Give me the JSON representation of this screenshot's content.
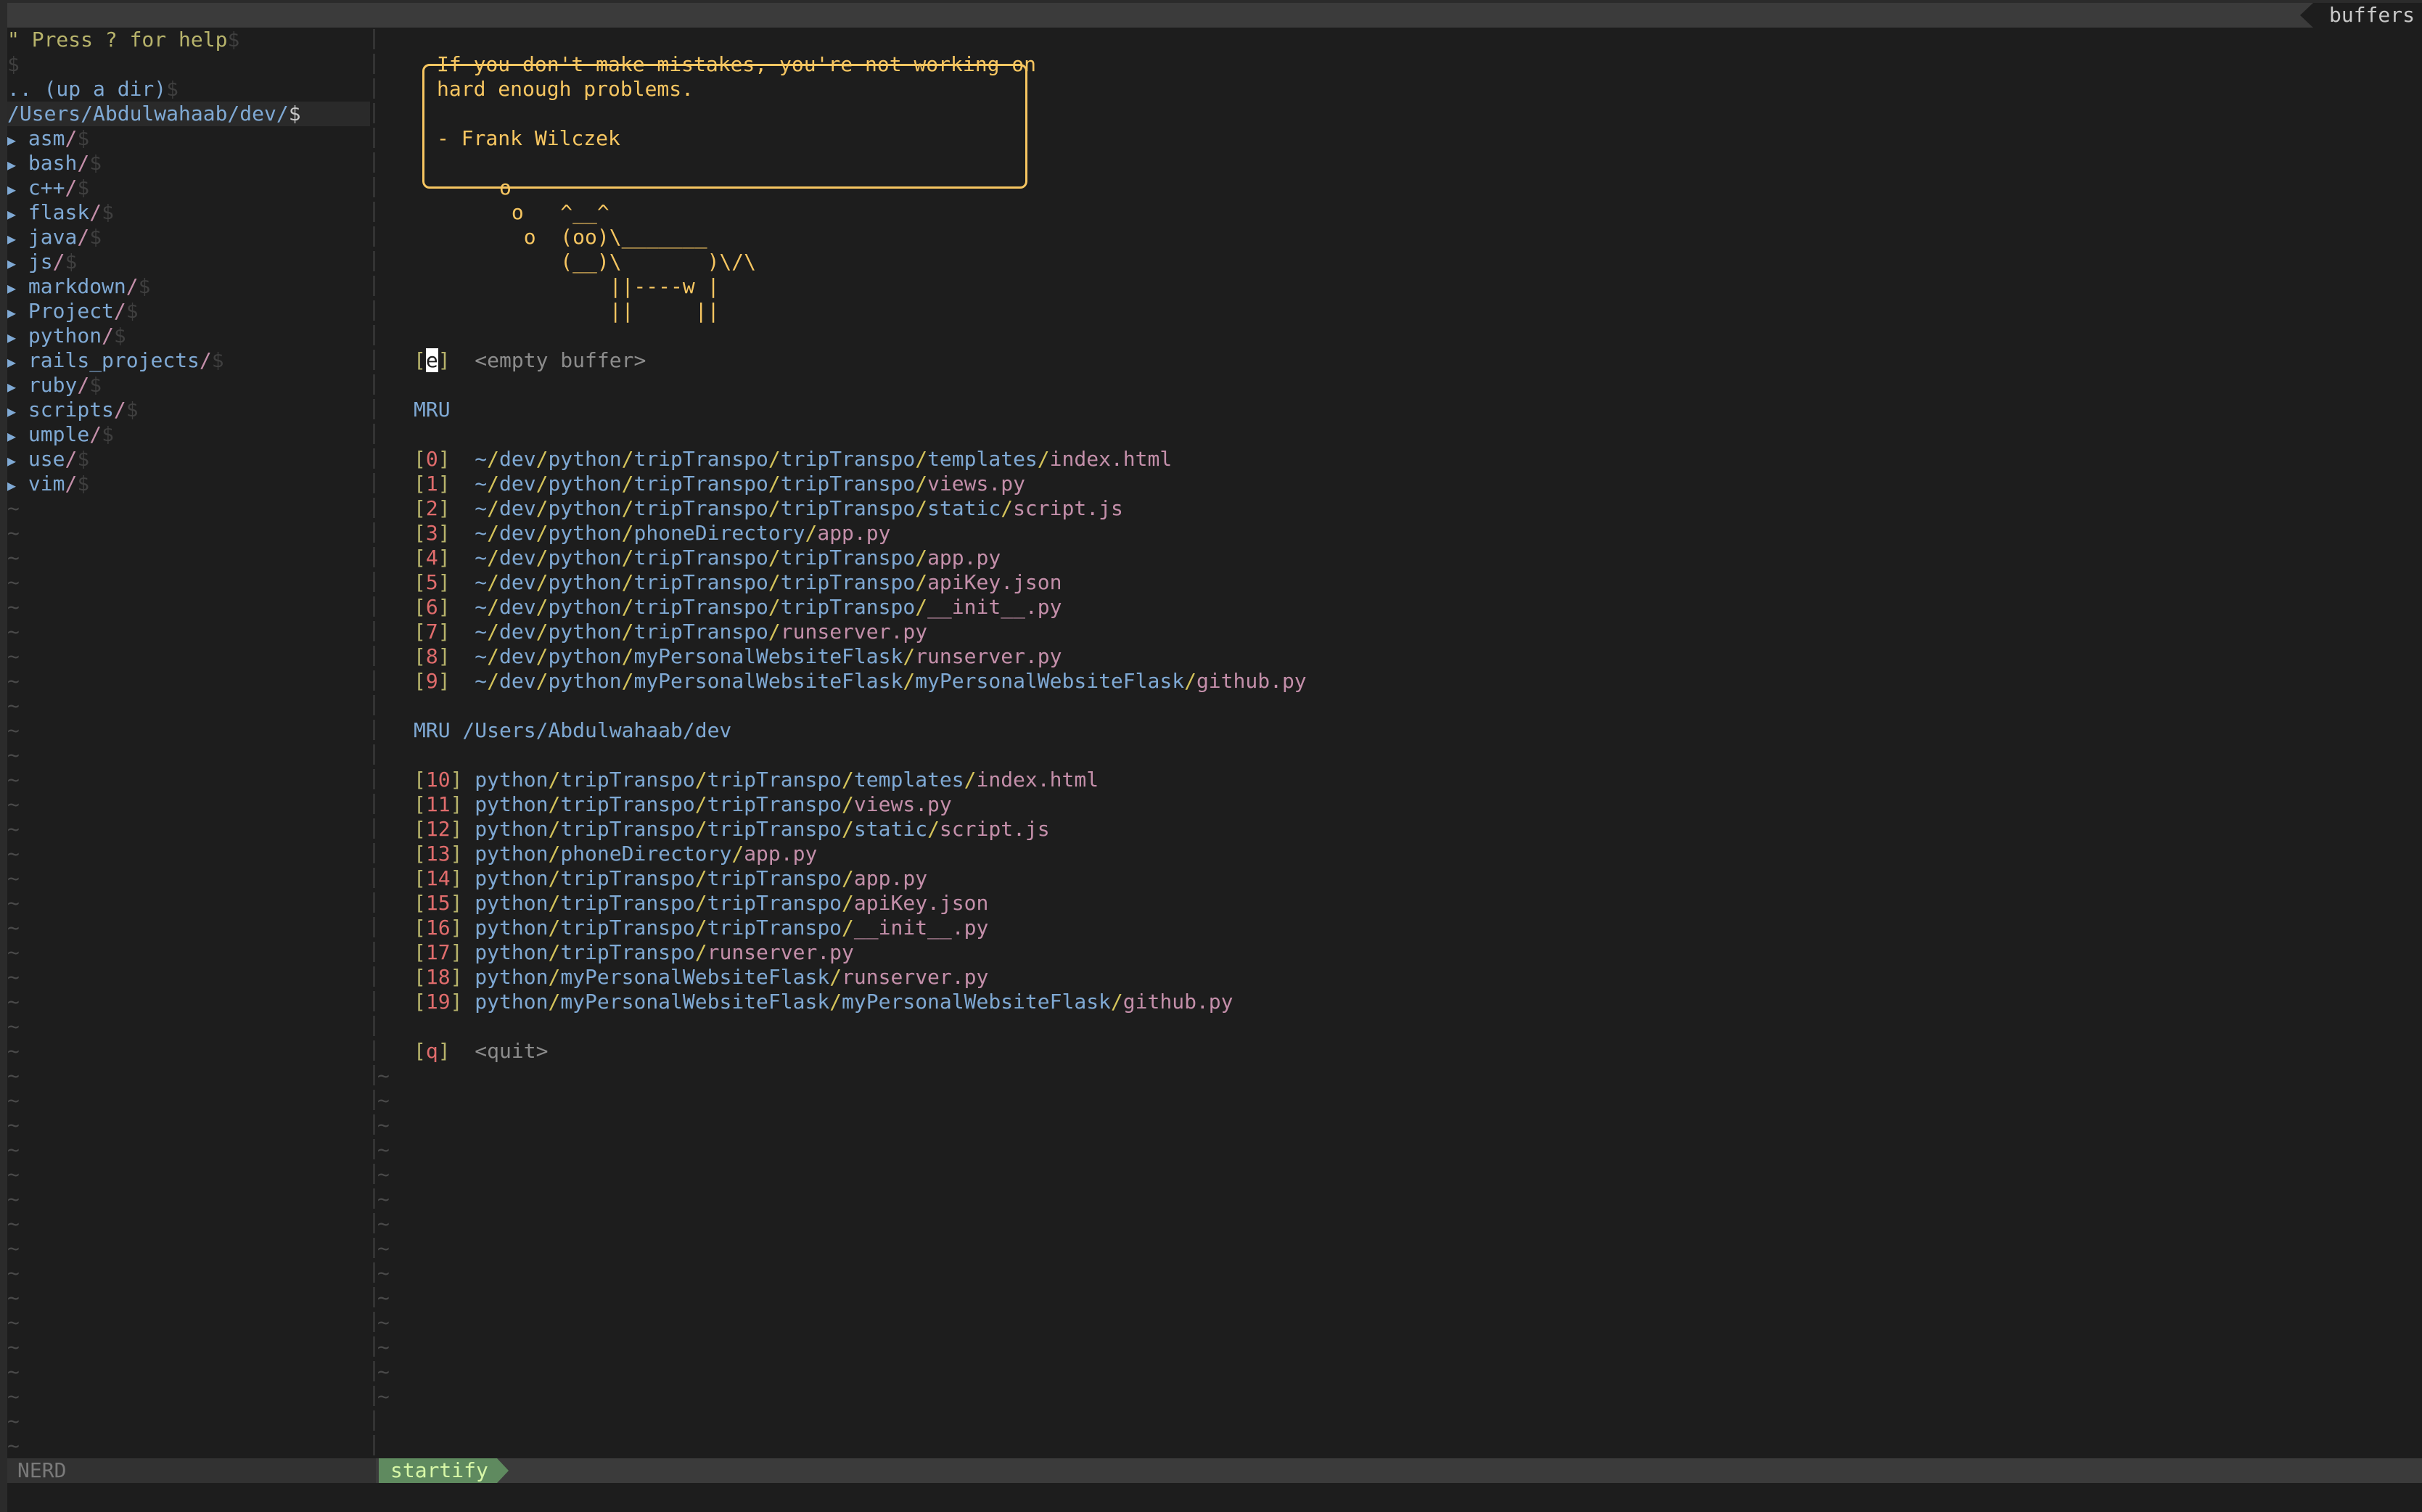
{
  "tabline": {
    "right_label": "buffers"
  },
  "sidebar": {
    "help_text": "\" Press ? for help",
    "eol_marker": "$",
    "up_dir": ".. (up a dir)",
    "root_path": "/Users/Abdulwahaab/dev/",
    "items": [
      {
        "name": "asm"
      },
      {
        "name": "bash"
      },
      {
        "name": "c++"
      },
      {
        "name": "flask"
      },
      {
        "name": "java"
      },
      {
        "name": "js"
      },
      {
        "name": "markdown"
      },
      {
        "name": "Project"
      },
      {
        "name": "python"
      },
      {
        "name": "rails_projects"
      },
      {
        "name": "ruby"
      },
      {
        "name": "scripts"
      },
      {
        "name": "umple"
      },
      {
        "name": "use"
      },
      {
        "name": "vim"
      }
    ],
    "tilde": "~"
  },
  "startify": {
    "quote_lines": [
      "If you don't make mistakes, you're not working on",
      "hard enough problems.",
      "",
      "- Frank Wilczek"
    ],
    "cow_lines": [
      "       o",
      "        o   ^__^",
      "         o  (oo)\\_______",
      "            (__)\\       )\\/\\",
      "                ||----w |",
      "                ||     ||"
    ],
    "empty_buffer": {
      "key": "e",
      "label": "<empty buffer>"
    },
    "mru_header": "MRU",
    "mru": [
      {
        "key": "0",
        "prefix": "~/",
        "dirs": [
          "dev",
          "python",
          "tripTranspo",
          "tripTranspo",
          "templates"
        ],
        "file": "index.html"
      },
      {
        "key": "1",
        "prefix": "~/",
        "dirs": [
          "dev",
          "python",
          "tripTranspo",
          "tripTranspo"
        ],
        "file": "views.py"
      },
      {
        "key": "2",
        "prefix": "~/",
        "dirs": [
          "dev",
          "python",
          "tripTranspo",
          "tripTranspo",
          "static"
        ],
        "file": "script.js"
      },
      {
        "key": "3",
        "prefix": "~/",
        "dirs": [
          "dev",
          "python",
          "phoneDirectory"
        ],
        "file": "app.py"
      },
      {
        "key": "4",
        "prefix": "~/",
        "dirs": [
          "dev",
          "python",
          "tripTranspo",
          "tripTranspo"
        ],
        "file": "app.py"
      },
      {
        "key": "5",
        "prefix": "~/",
        "dirs": [
          "dev",
          "python",
          "tripTranspo",
          "tripTranspo"
        ],
        "file": "apiKey.json"
      },
      {
        "key": "6",
        "prefix": "~/",
        "dirs": [
          "dev",
          "python",
          "tripTranspo",
          "tripTranspo"
        ],
        "file": "__init__.py"
      },
      {
        "key": "7",
        "prefix": "~/",
        "dirs": [
          "dev",
          "python",
          "tripTranspo"
        ],
        "file": "runserver.py"
      },
      {
        "key": "8",
        "prefix": "~/",
        "dirs": [
          "dev",
          "python",
          "myPersonalWebsiteFlask"
        ],
        "file": "runserver.py"
      },
      {
        "key": "9",
        "prefix": "~/",
        "dirs": [
          "dev",
          "python",
          "myPersonalWebsiteFlask",
          "myPersonalWebsiteFlask"
        ],
        "file": "github.py"
      }
    ],
    "mru_dir_header": "MRU /Users/Abdulwahaab/dev",
    "mru_dir": [
      {
        "key": "10",
        "prefix": "",
        "dirs": [
          "python",
          "tripTranspo",
          "tripTranspo",
          "templates"
        ],
        "file": "index.html"
      },
      {
        "key": "11",
        "prefix": "",
        "dirs": [
          "python",
          "tripTranspo",
          "tripTranspo"
        ],
        "file": "views.py"
      },
      {
        "key": "12",
        "prefix": "",
        "dirs": [
          "python",
          "tripTranspo",
          "tripTranspo",
          "static"
        ],
        "file": "script.js"
      },
      {
        "key": "13",
        "prefix": "",
        "dirs": [
          "python",
          "phoneDirectory"
        ],
        "file": "app.py"
      },
      {
        "key": "14",
        "prefix": "",
        "dirs": [
          "python",
          "tripTranspo",
          "tripTranspo"
        ],
        "file": "app.py"
      },
      {
        "key": "15",
        "prefix": "",
        "dirs": [
          "python",
          "tripTranspo",
          "tripTranspo"
        ],
        "file": "apiKey.json"
      },
      {
        "key": "16",
        "prefix": "",
        "dirs": [
          "python",
          "tripTranspo",
          "tripTranspo"
        ],
        "file": "__init__.py"
      },
      {
        "key": "17",
        "prefix": "",
        "dirs": [
          "python",
          "tripTranspo"
        ],
        "file": "runserver.py"
      },
      {
        "key": "18",
        "prefix": "",
        "dirs": [
          "python",
          "myPersonalWebsiteFlask"
        ],
        "file": "runserver.py"
      },
      {
        "key": "19",
        "prefix": "",
        "dirs": [
          "python",
          "myPersonalWebsiteFlask",
          "myPersonalWebsiteFlask"
        ],
        "file": "github.py"
      }
    ],
    "quit": {
      "key": "q",
      "label": "<quit>"
    }
  },
  "statusline": {
    "left_label": "NERD",
    "mode_label": "startify"
  },
  "colors": {
    "background": "#1d1d1d",
    "quote": "#f7c661",
    "directory": "#7fa9d4",
    "file": "#c48faa",
    "index": "#e06c6c",
    "bracket": "#b7b36b",
    "status_mode_bg": "#5f8a5f"
  }
}
